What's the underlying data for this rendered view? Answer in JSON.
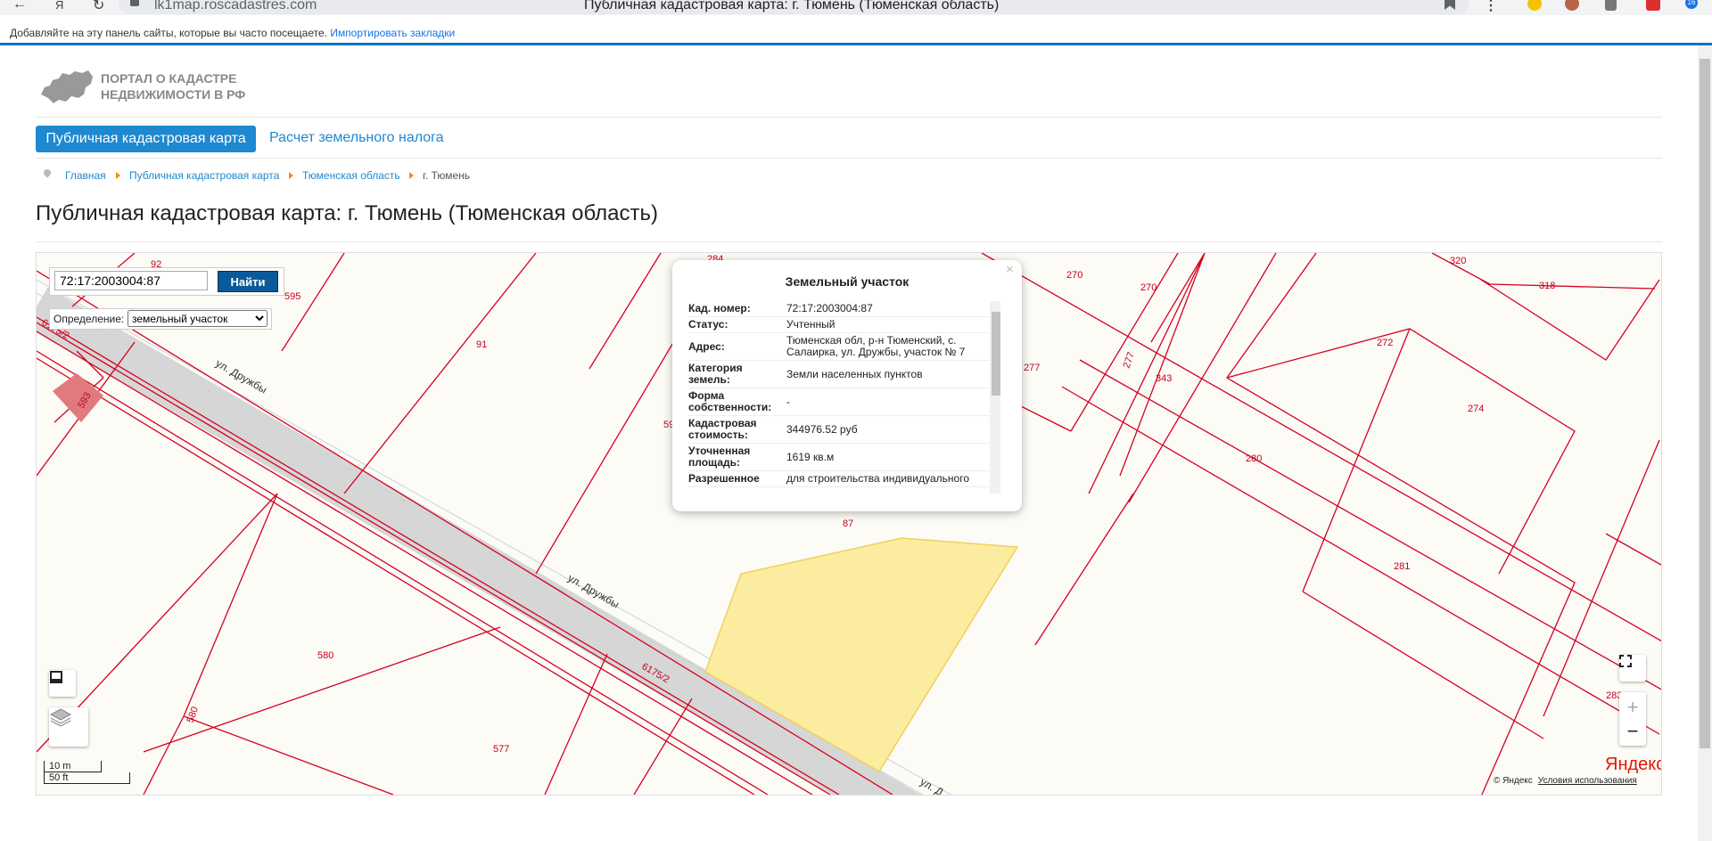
{
  "browser": {
    "url": "lk1map.roscadastres.com",
    "tab_title": "Публичная кадастровая карта: г. Тюмень (Тюменская область)",
    "bookmarks_text": "Добавляйте на эту панель сайты, которые вы часто посещаете.",
    "bookmarks_link": "Импортировать закладки",
    "badge_count": "16"
  },
  "site": {
    "logo_line1": "ПОРТАЛ О КАДАСТРЕ",
    "logo_line2": "НЕДВИЖИМОСТИ В РФ",
    "tabs": [
      "Публичная кадастровая карта",
      "Расчет земельного налога"
    ],
    "breadcrumbs": [
      "Главная",
      "Публичная кадастровая карта",
      "Тюменская область",
      "г. Тюмень"
    ],
    "heading": "Публичная кадастровая карта: г. Тюмень (Тюменская область)"
  },
  "map": {
    "search_value": "72:17:2003004:87",
    "search_button": "Найти",
    "definition_label": "Определение:",
    "definition_options": [
      "земельный участок"
    ],
    "scale_m": "10 m",
    "scale_ft": "50 ft",
    "yandex_logo": "Яндекс",
    "copyright": "© Яндекс",
    "terms": "Условия использования",
    "streets": [
      "ул. Дружбы",
      "ул. Дружбы",
      "ул. Д"
    ],
    "parcel_labels": [
      "92",
      "595",
      "6175/2",
      "91",
      "593",
      "594",
      "580",
      "580",
      "577",
      "6175/2",
      "270",
      "270",
      "277",
      "277",
      "320",
      "318",
      "272",
      "343",
      "274",
      "280",
      "281",
      "283",
      "87",
      "284"
    ]
  },
  "popup": {
    "title": "Земельный участок",
    "rows": [
      {
        "label": "Кад. номер:",
        "value": "72:17:2003004:87"
      },
      {
        "label": "Статус:",
        "value": "Учтенный"
      },
      {
        "label": "Адрес:",
        "value": "Тюменская обл, р-н Тюменский, с. Салаирка, ул. Дружбы, участок № 7"
      },
      {
        "label": "Категория земель:",
        "value": "Земли населенных пунктов"
      },
      {
        "label": "Форма собственности:",
        "value": "-"
      },
      {
        "label": "Кадастровая стоимость:",
        "value": "344976.52 руб"
      },
      {
        "label": "Уточненная площадь:",
        "value": "1619 кв.м"
      },
      {
        "label": "Разрешенное",
        "value": "для строительства индивидуального"
      }
    ]
  }
}
